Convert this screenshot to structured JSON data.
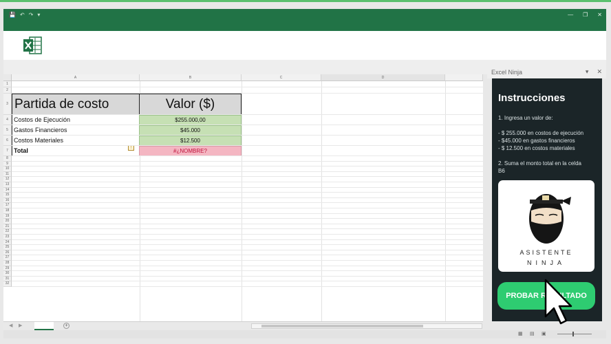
{
  "app": {
    "accent_color": "#217346",
    "logo_icon": "excel-logo-icon"
  },
  "columns": [
    "A",
    "B",
    "C",
    "D"
  ],
  "rows": [
    "1",
    "2",
    "3",
    "4",
    "5",
    "6",
    "7",
    "8",
    "9",
    "10",
    "11",
    "12",
    "13",
    "14",
    "15",
    "16",
    "17",
    "18",
    "19",
    "20",
    "21",
    "22",
    "23",
    "24",
    "25",
    "26",
    "27",
    "28",
    "29",
    "30",
    "31",
    "32"
  ],
  "sheet": {
    "header_item": "Partida de costo",
    "header_value": "Valor ($)",
    "items": [
      {
        "label": "Costos de Ejecución",
        "value": "$255.000,00"
      },
      {
        "label": "Gastos Financieros",
        "value": "$45.000"
      },
      {
        "label": "Costos Materiales",
        "value": "$12.500"
      }
    ],
    "total_label": "Total",
    "total_value": "#¿NOMBRE?",
    "value_fill_color": "#c6e0b4",
    "error_fill_color": "#f4b6c2"
  },
  "task_pane": {
    "title": "Excel Ninja",
    "heading": "Instrucciones",
    "step1": "1. Ingresa un valor de:",
    "bullets": [
      "- $ 255.000 en costos de ejecución",
      "- $45.000 en gastos financieros",
      "- $ 12.500 en costos materiales"
    ],
    "step2_line1": "2. Suma el monto total en la celda",
    "step2_line2": "B6",
    "brand_line1": "ASISTENTE",
    "brand_line2": "NINJA",
    "button_label": "PROBAR RESULTADO",
    "button_color": "#2ecc71",
    "background_color": "#1b2528"
  }
}
